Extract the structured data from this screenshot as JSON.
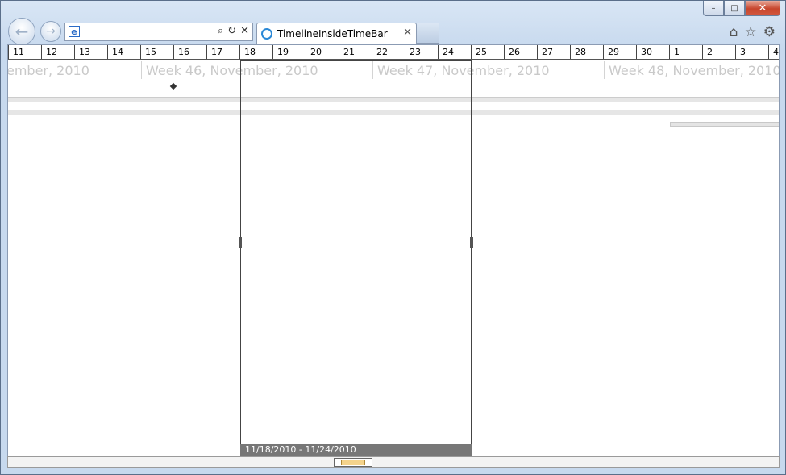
{
  "window": {
    "minimize": "–",
    "maximize": "□",
    "close": "✕"
  },
  "nav": {
    "back": "←",
    "forward": "→"
  },
  "address": {
    "value": "",
    "search": "⌕",
    "refresh": "↻",
    "stop": "✕"
  },
  "tab": {
    "title": "TimelineInsideTimeBar",
    "close": "✕"
  },
  "toolbar": {
    "home": "⌂",
    "favorites": "☆",
    "tools": "⚙"
  },
  "timeline": {
    "days": [
      "11",
      "12",
      "13",
      "14",
      "15",
      "16",
      "17",
      "18",
      "19",
      "20",
      "21",
      "22",
      "23",
      "24",
      "25",
      "26",
      "27",
      "28",
      "29",
      "30",
      "1",
      "2",
      "3",
      "4"
    ],
    "weeks": [
      "ember, 2010",
      "Week 46, November, 2010",
      "Week 47, November, 2010",
      "Week 48, November, 2010"
    ],
    "selection_label": "11/18/2010 - 11/24/2010"
  }
}
